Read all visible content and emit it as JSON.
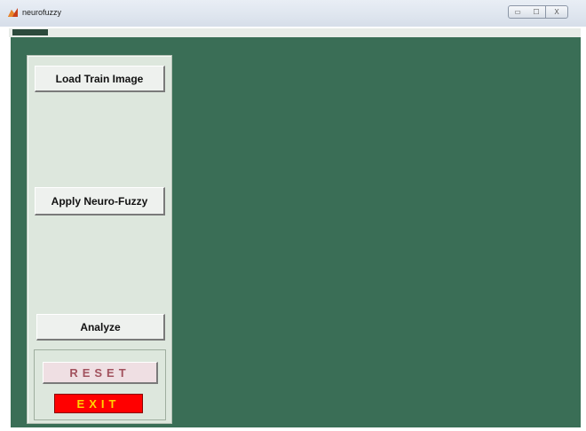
{
  "window": {
    "title": "neurofuzzy",
    "icon": "matlab-icon",
    "controls": {
      "minimize_symbol": "▭",
      "maximize_symbol": "☐",
      "close_symbol": "X"
    }
  },
  "panel": {
    "buttons": {
      "load_label": "Load Train Image",
      "apply_label": "Apply Neuro-Fuzzy",
      "analyze_label": "Analyze",
      "reset_label": "RESET",
      "exit_label": "EXIT"
    }
  },
  "colors": {
    "background_green": "#3a6e56",
    "panel_bg": "#dde7dd",
    "exit_bg": "#ff0000",
    "exit_text": "#ffd400",
    "reset_text": "#a2525e"
  }
}
